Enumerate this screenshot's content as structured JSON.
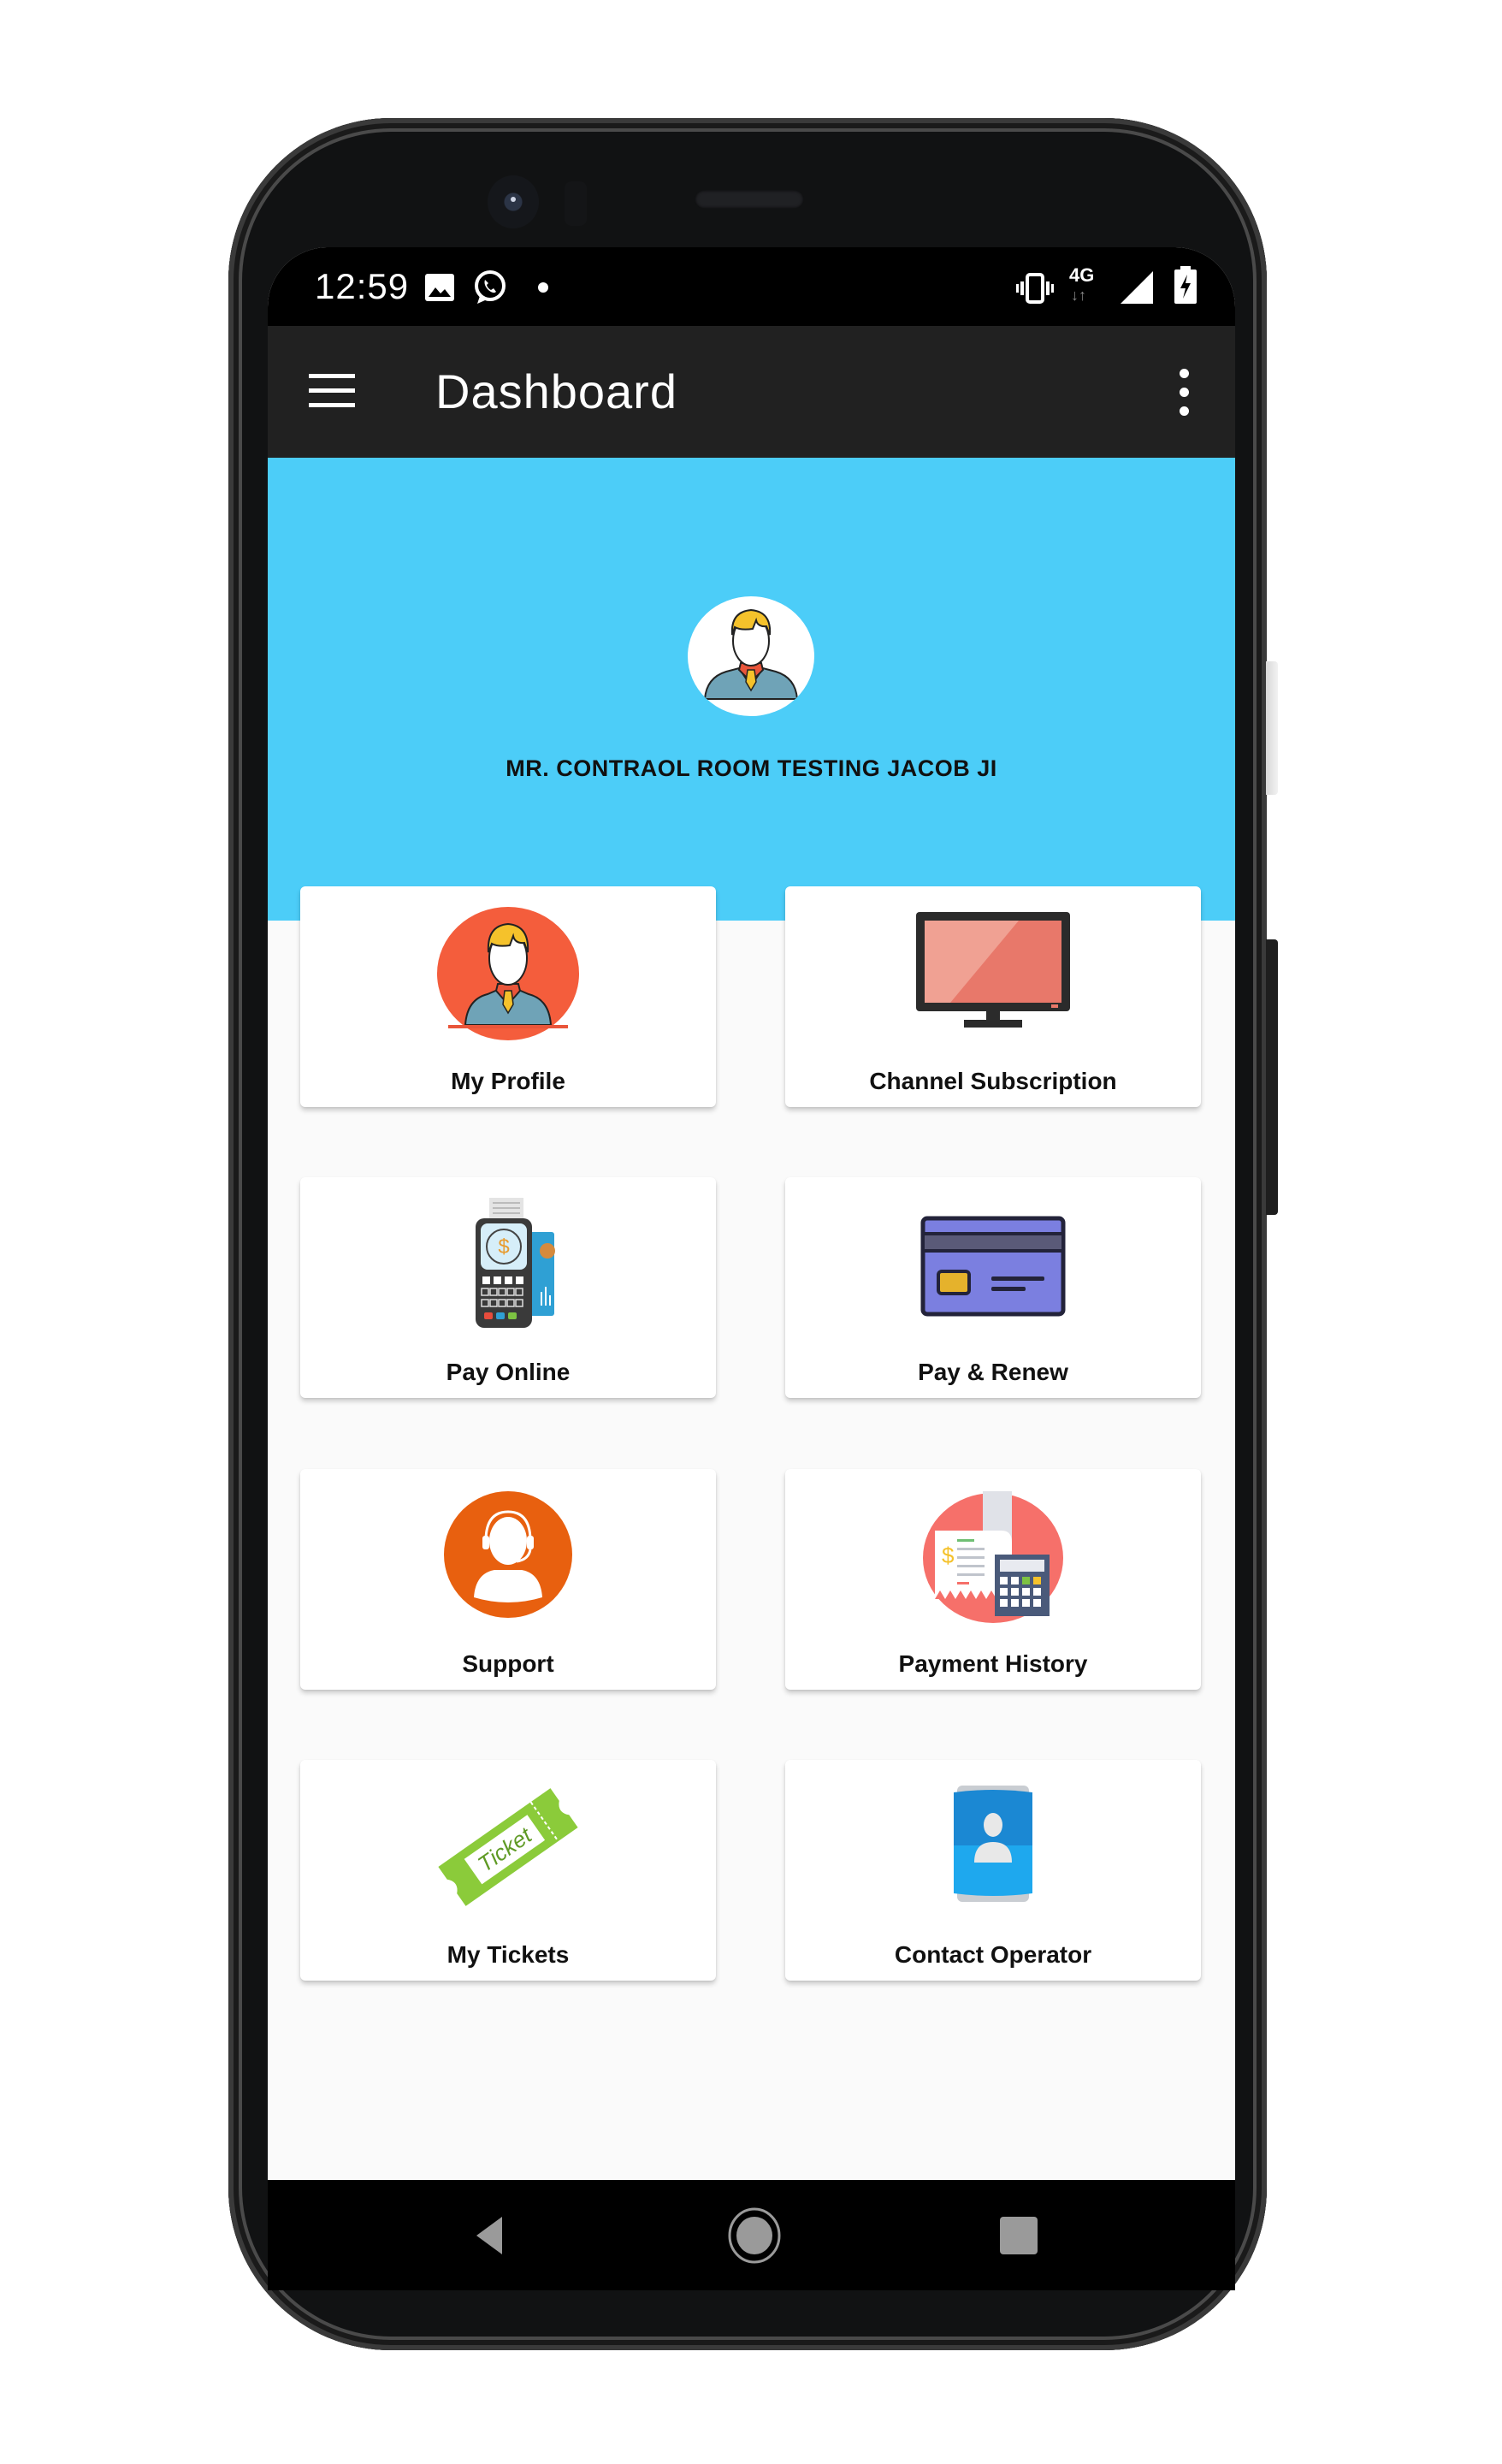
{
  "status_bar": {
    "time": "12:59",
    "left_icons": [
      "image-notification-icon",
      "whatsapp-icon",
      "notification-dot-icon"
    ],
    "right_icons": [
      "vibrate-icon",
      "4g-data-icon",
      "signal-icon",
      "battery-charging-icon"
    ],
    "network_label": "4G"
  },
  "toolbar": {
    "title": "Dashboard",
    "menu_icon": "hamburger-menu-icon",
    "overflow_icon": "more-vert-icon"
  },
  "header": {
    "user_name": "MR. CONTRAOL ROOM TESTING JACOB JI",
    "avatar_icon": "user-avatar-icon",
    "background_color": "#4ccdf8"
  },
  "menu": [
    {
      "label": "My Profile",
      "icon": "profile-icon"
    },
    {
      "label": "Channel Subscription",
      "icon": "tv-monitor-icon"
    },
    {
      "label": "Pay Online",
      "icon": "card-terminal-icon"
    },
    {
      "label": "Pay & Renew",
      "icon": "credit-card-icon"
    },
    {
      "label": "Support",
      "icon": "support-headset-icon"
    },
    {
      "label": "Payment History",
      "icon": "receipt-calculator-icon"
    },
    {
      "label": "My Tickets",
      "icon": "ticket-icon"
    },
    {
      "label": "Contact Operator",
      "icon": "contact-card-icon"
    }
  ],
  "ticket_icon_text": "Ticket",
  "nav_bar": {
    "back": "back-icon",
    "home": "home-icon",
    "recents": "recents-icon"
  },
  "colors": {
    "toolbar": "#212121",
    "accent_blue": "#4ccdf8",
    "profile_orange": "#f45d3c",
    "support_orange": "#e8600f",
    "ticket_green": "#8bcb3a",
    "contact_blue": "#1e9be8",
    "card_purple": "#7b7fe0"
  }
}
